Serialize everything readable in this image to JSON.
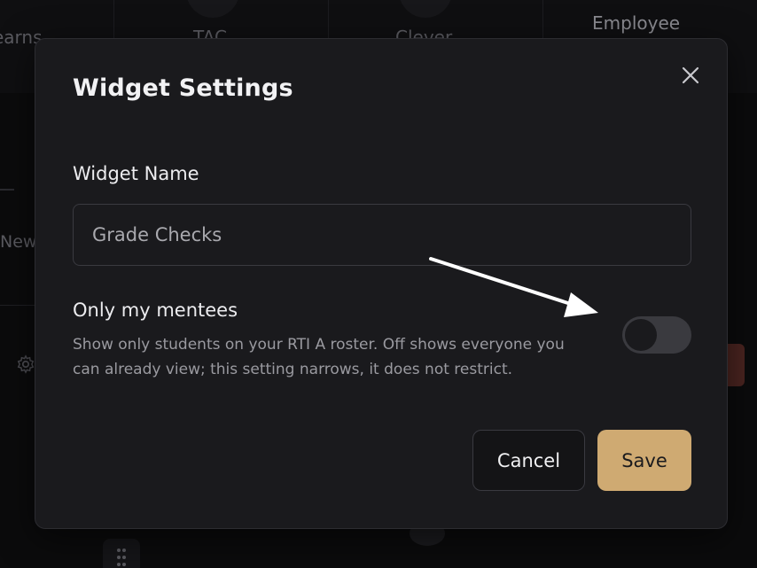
{
  "background": {
    "tiles": [
      "earns",
      "TAC",
      "Clever",
      "Employee"
    ],
    "side_text": "New"
  },
  "modal": {
    "title": "Widget Settings",
    "close_icon": "close-icon",
    "name_field": {
      "label": "Widget Name",
      "value": "Grade Checks"
    },
    "mentees_toggle": {
      "title": "Only my mentees",
      "description": "Show only students on your RTI A roster. Off shows everyone you can already view; this setting narrows, it does not restrict.",
      "state": "off"
    },
    "actions": {
      "cancel_label": "Cancel",
      "save_label": "Save"
    }
  },
  "colors": {
    "modal_bg": "#1a1a1d",
    "accent": "#cfaa72",
    "toggle_track": "#3a3a3f",
    "text_muted": "#9a9aa0"
  }
}
